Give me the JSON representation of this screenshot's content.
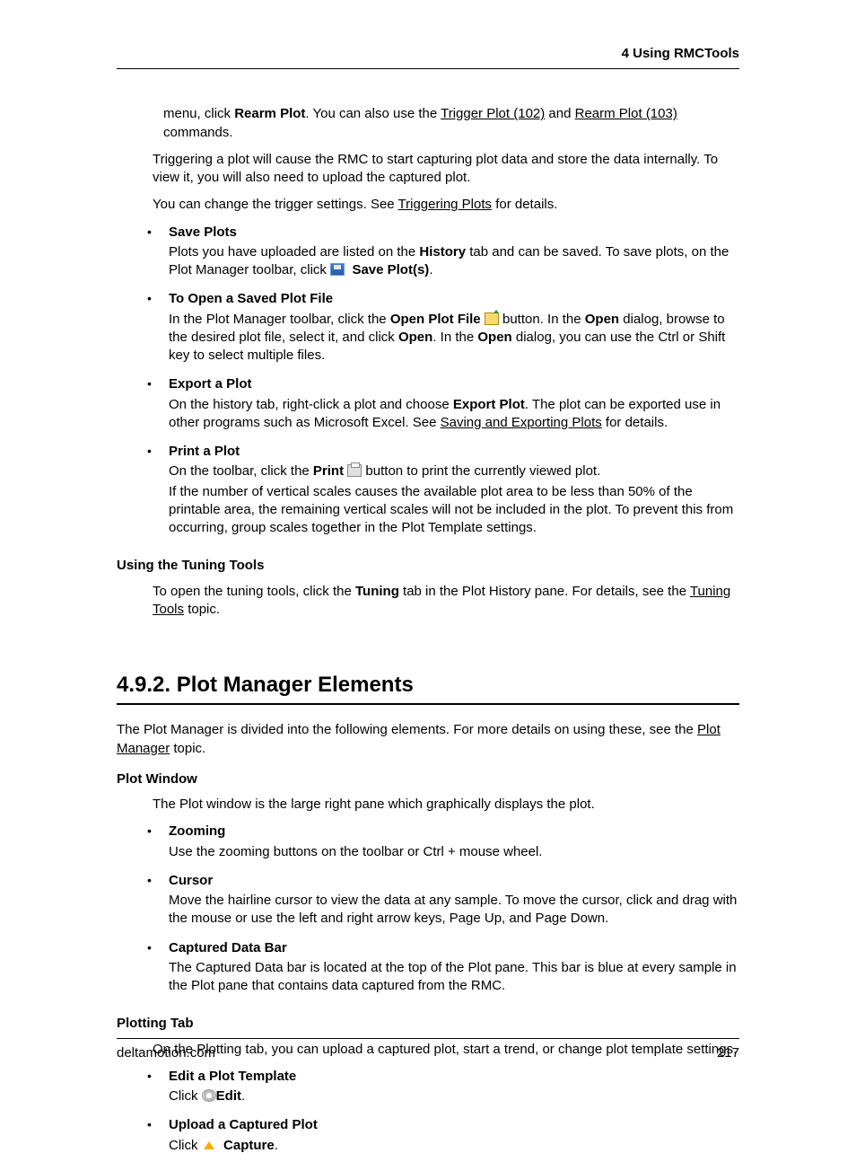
{
  "header": {
    "chapter": "4  Using RMCTools"
  },
  "top_fragment": {
    "menu_click_prefix": "menu, click ",
    "rearm_plot_bold": "Rearm Plot",
    "afterbold": ". You can also use the ",
    "link_trigger": "Trigger Plot (102)",
    "and": " and ",
    "link_rearm": "Rearm Plot (103)",
    "commands_suffix": " commands.",
    "trigger_para": "Triggering a plot will cause the RMC to start capturing plot data and store the data internally. To view it, you will also need to upload the captured plot.",
    "trigger_settings_prefix": "You can change the trigger settings. See ",
    "trigger_settings_link": "Triggering Plots",
    "trigger_settings_suffix": " for details."
  },
  "bullets_a": [
    {
      "title": "Save Plots",
      "body_prefix": "Plots you have uploaded are listed on the ",
      "body_bold1": "History",
      "body_mid": " tab and can be saved. To save plots, on the Plot Manager toolbar, click ",
      "icon": "save",
      "body_bold2": "Save Plot(s)",
      "body_suffix": "."
    },
    {
      "title": "To Open a Saved Plot File",
      "body_prefix": "In the Plot Manager toolbar, click the ",
      "body_bold1": "Open Plot File",
      "icon": "open",
      "body_mid2": " button. In the ",
      "body_bold2": "Open",
      "body_mid3": " dialog, browse to the desired plot file, select it, and click ",
      "body_bold3": "Open",
      "body_mid4": ". In the ",
      "body_bold4": "Open",
      "body_suffix": " dialog, you can use the Ctrl or Shift key to select multiple files."
    },
    {
      "title": "Export a Plot",
      "body_prefix": "On the history tab, right-click a plot and choose ",
      "body_bold1": "Export Plot",
      "body_mid": ". The plot can be exported use in other programs such as Microsoft Excel. See ",
      "link": "Saving and Exporting Plots",
      "body_suffix": " for details."
    },
    {
      "title": "Print a Plot",
      "body_prefix": "On the toolbar, click the ",
      "body_bold1": "Print",
      "icon": "print",
      "body_mid": " button to print the currently viewed plot.",
      "body_para2": "If the number of vertical scales causes the available plot area to be less than 50% of the printable area, the remaining vertical scales will not be included in the plot. To prevent this from occurring, group scales together in the Plot Template settings."
    }
  ],
  "tuning": {
    "heading": "Using the Tuning Tools",
    "prefix": "To open the tuning tools, click the ",
    "bold": "Tuning",
    "mid": " tab in the Plot History pane. For details, see the ",
    "link": "Tuning Tools",
    "suffix": " topic."
  },
  "section": {
    "title": "4.9.2. Plot Manager Elements",
    "intro_prefix": "The Plot Manager is divided into the following elements. For more details on using these, see the ",
    "intro_link": "Plot Manager",
    "intro_suffix": " topic."
  },
  "plot_window": {
    "heading": "Plot Window",
    "intro": "The Plot window is the large right pane which graphically displays the plot.",
    "items": [
      {
        "title": "Zooming",
        "body": "Use the zooming buttons on the toolbar or Ctrl + mouse wheel."
      },
      {
        "title": "Cursor",
        "body": "Move the hairline cursor to view the data at any sample. To move the cursor, click and drag with the mouse or use the left and right arrow keys, Page Up, and Page Down."
      },
      {
        "title": "Captured Data Bar",
        "body": "The Captured Data bar is located at the top of the Plot pane. This bar is blue at every sample in the Plot pane that contains data captured from the RMC."
      }
    ]
  },
  "plotting_tab": {
    "heading": "Plotting Tab",
    "intro": "On the Plotting tab, you can upload a captured plot, start a trend, or change plot template settings.",
    "items": [
      {
        "title": "Edit a Plot Template",
        "click": "Click ",
        "icon": "gear",
        "bold": "Edit",
        "suffix": "."
      },
      {
        "title": "Upload a Captured Plot",
        "click": "Click ",
        "icon": "upload",
        "bold": "Capture",
        "suffix": "."
      }
    ]
  },
  "footer": {
    "site": "deltamotion.com",
    "page": "217"
  }
}
